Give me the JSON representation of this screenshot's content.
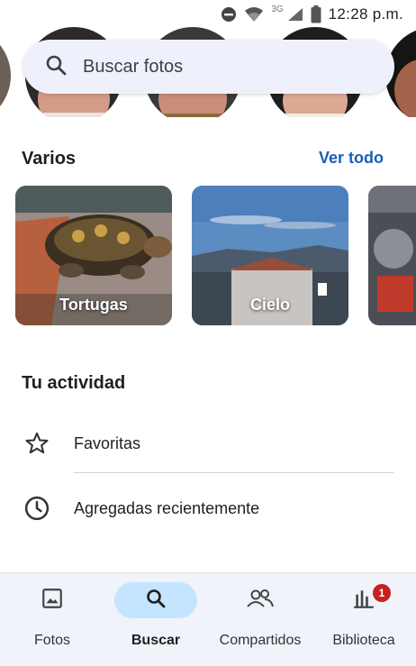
{
  "status_bar": {
    "network": "3G",
    "time": "12:28 p.m."
  },
  "search": {
    "placeholder": "Buscar fotos"
  },
  "varios": {
    "title": "Varios",
    "see_all": "Ver todo",
    "cards": [
      {
        "label": "Tortugas"
      },
      {
        "label": "Cielo"
      },
      {
        "label": ""
      }
    ]
  },
  "activity": {
    "title": "Tu actividad",
    "items": [
      {
        "label": "Favoritas",
        "icon": "star-icon"
      },
      {
        "label": "Agregadas recientemente",
        "icon": "clock-icon"
      }
    ]
  },
  "bottom_nav": {
    "items": [
      {
        "label": "Fotos",
        "icon": "photo-icon",
        "active": false
      },
      {
        "label": "Buscar",
        "icon": "search-icon",
        "active": true
      },
      {
        "label": "Compartidos",
        "icon": "people-icon",
        "active": false
      },
      {
        "label": "Biblioteca",
        "icon": "library-icon",
        "active": false,
        "badge": "1"
      }
    ]
  },
  "colors": {
    "accent": "#1a5fb4",
    "active_pill": "#c4e4ff",
    "nav_background": "#f0f3fa",
    "badge": "#c5221f"
  }
}
